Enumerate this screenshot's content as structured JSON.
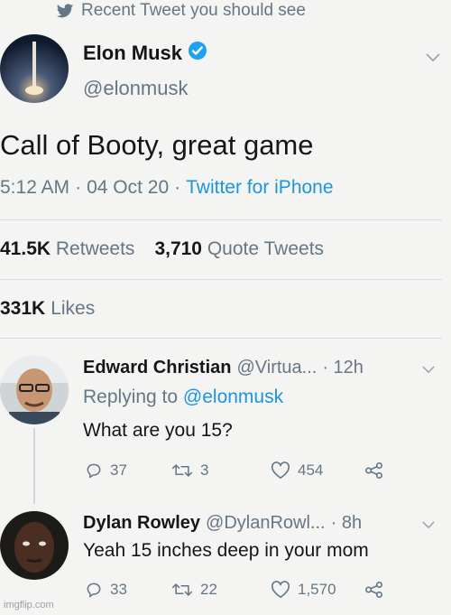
{
  "header": {
    "label": "Recent Tweet you should see"
  },
  "tweet": {
    "name": "Elon Musk",
    "handle": "@elonmusk",
    "text": "Call of Booty, great game",
    "time": "5:12 AM",
    "date": "04 Oct 20",
    "source": "Twitter for iPhone",
    "retweets": "41.5K",
    "retweets_label": "Retweets",
    "quotes": "3,710",
    "quotes_label": "Quote Tweets",
    "likes": "331K",
    "likes_label": "Likes"
  },
  "replies": [
    {
      "name": "Edward Christian",
      "handle": "@Virtua...",
      "time": "· 12h",
      "replying_prefix": "Replying to",
      "replying_to": "@elonmusk",
      "text": "What are you 15?",
      "replies": "37",
      "retweets": "3",
      "likes": "454"
    },
    {
      "name": "Dylan Rowley",
      "handle": "@DylanRowl...",
      "time": "· 8h",
      "text": "Yeah 15 inches deep in your mom",
      "replies": "33",
      "retweets": "22",
      "likes": "1,570"
    }
  ],
  "watermark": "imgflip.com",
  "colors": {
    "link": "#1b95e0",
    "muted": "#657786",
    "text": "#14171a",
    "verified": "#1da1f2"
  },
  "icons": [
    "twitter-bird-icon",
    "verified-badge-icon",
    "chevron-down-icon",
    "reply-icon",
    "retweet-icon",
    "like-icon",
    "share-icon"
  ]
}
